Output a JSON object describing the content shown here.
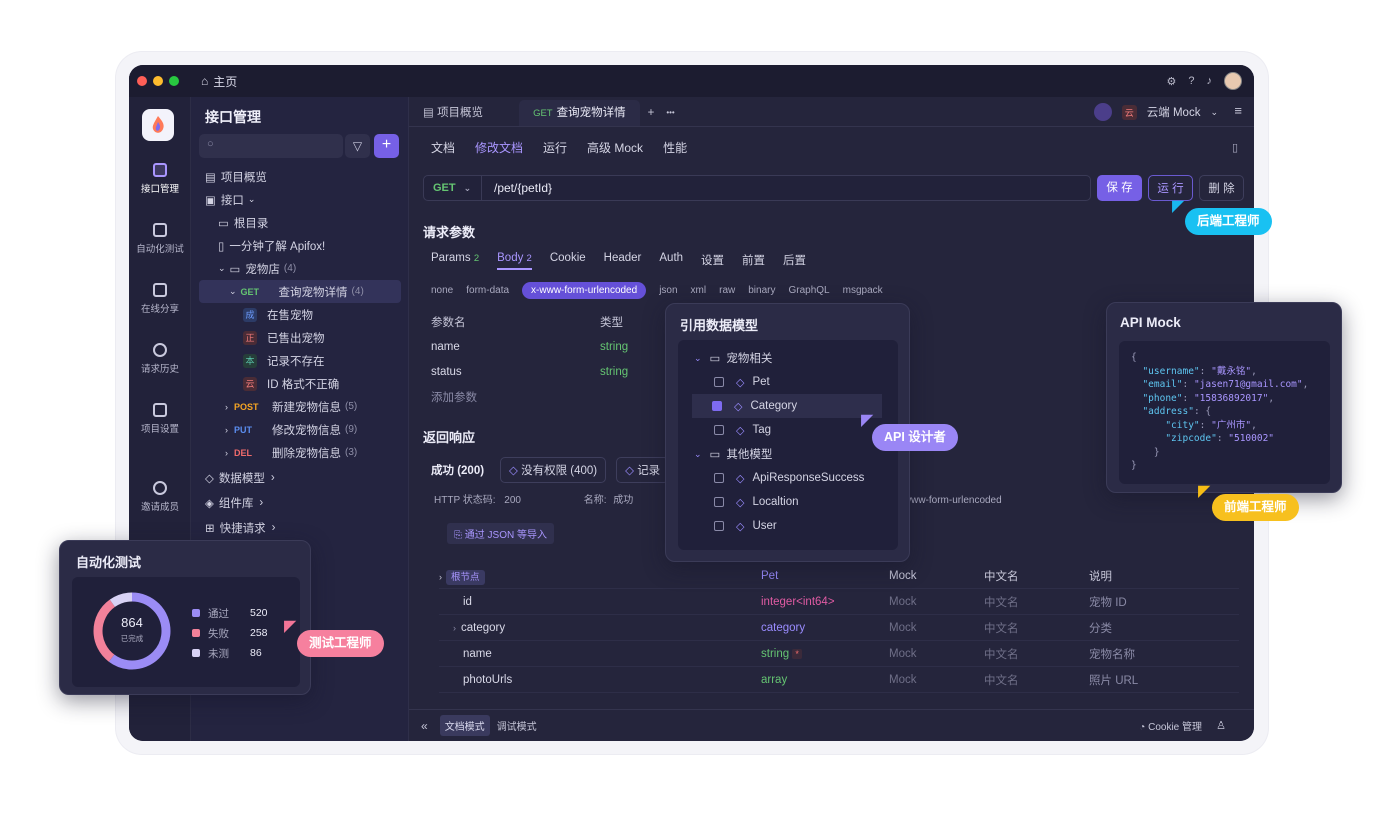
{
  "titlebar": {
    "home": "主页"
  },
  "rail": [
    {
      "label": "接口管理",
      "icon": "api-icon"
    },
    {
      "label": "自动化测试",
      "icon": "test-icon"
    },
    {
      "label": "在线分享",
      "icon": "share-icon"
    },
    {
      "label": "请求历史",
      "icon": "history-icon"
    },
    {
      "label": "项目设置",
      "icon": "settings-icon"
    },
    {
      "label": "邀请成员",
      "icon": "invite-icon"
    }
  ],
  "sidebar": {
    "title": "接口管理",
    "tree": {
      "overview": "项目概览",
      "api": "接口",
      "root": "根目录",
      "intro": "一分钟了解 Apifox!",
      "folder": "宠物店",
      "folder_count": "(4)",
      "get_method": "GET",
      "get_name": "查询宠物详情",
      "get_count": "(4)",
      "cases": [
        {
          "badge": "成",
          "name": "在售宠物"
        },
        {
          "badge": "正",
          "name": "已售出宠物"
        },
        {
          "badge": "本",
          "name": "记录不存在"
        },
        {
          "badge": "云",
          "name": "ID 格式不正确"
        }
      ],
      "post_method": "POST",
      "post_name": "新建宠物信息",
      "post_count": "(5)",
      "put_method": "PUT",
      "put_name": "修改宠物信息",
      "put_count": "(9)",
      "del_method": "DEL",
      "del_name": "删除宠物信息",
      "del_count": "(3)",
      "schemas": "数据模型",
      "components": "组件库",
      "quick": "快捷请求"
    }
  },
  "tabs": {
    "overview": "项目概览",
    "active_method": "GET",
    "active_name": "查询宠物详情",
    "add": "+",
    "more": "•••",
    "env": "云端 Mock",
    "env_badge": "云"
  },
  "subtabs": [
    "文档",
    "修改文档",
    "运行",
    "高级 Mock",
    "性能"
  ],
  "request": {
    "method": "GET",
    "url": "/pet/{petId}",
    "save": "保 存",
    "run": "运 行",
    "delete": "删 除"
  },
  "params": {
    "title": "请求参数",
    "tabs": [
      {
        "label": "Params",
        "count": "2"
      },
      {
        "label": "Body",
        "count": "2"
      },
      {
        "label": "Cookie"
      },
      {
        "label": "Header"
      },
      {
        "label": "Auth"
      },
      {
        "label": "设置"
      },
      {
        "label": "前置"
      },
      {
        "label": "后置"
      }
    ],
    "body_types": [
      "none",
      "form-data",
      "x-www-form-urlencoded",
      "json",
      "xml",
      "raw",
      "binary",
      "GraphQL",
      "msgpack"
    ],
    "headers": [
      "参数名",
      "类型"
    ],
    "rows": [
      {
        "name": "name",
        "type": "string"
      },
      {
        "name": "status",
        "type": "string"
      }
    ],
    "add": "添加参数",
    "status_desc": "状态"
  },
  "response": {
    "title": "返回响应",
    "tabs": [
      "成功 (200)",
      "没有权限 (400)",
      "记录"
    ],
    "status_label": "HTTP 状态码:",
    "status_value": "200",
    "name_label": "名称:",
    "name_value": "成功",
    "content_type": "plication/x-www-form-urlencoded",
    "import": "通过 JSON 等导入",
    "schema_header": [
      "根节点",
      "Pet",
      "Mock",
      "中文名",
      "说明"
    ],
    "schema_rows": [
      {
        "name": "id",
        "type": "integer<int64>",
        "mock": "Mock",
        "cn": "中文名",
        "desc": "宠物 ID"
      },
      {
        "name": "category",
        "type": "category",
        "mock": "Mock",
        "cn": "中文名",
        "desc": "分类"
      },
      {
        "name": "name",
        "type": "string",
        "required": "*",
        "mock": "Mock",
        "cn": "中文名",
        "desc": "宠物名称"
      },
      {
        "name": "photoUrls",
        "type": "array",
        "mock": "Mock",
        "cn": "中文名",
        "desc": "照片 URL"
      }
    ]
  },
  "bottom": {
    "doc_mode": "文档模式",
    "debug_mode": "调试模式",
    "cookie": "Cookie 管理"
  },
  "model_popup": {
    "title": "引用数据模型",
    "group1": "宠物相关",
    "group1_items": [
      "Pet",
      "Category",
      "Tag"
    ],
    "group2": "其他模型",
    "group2_items": [
      "ApiResponseSuccess",
      "Localtion",
      "User"
    ]
  },
  "mock_popup": {
    "title": "API Mock",
    "code": "{\n  \"username\": \"戴永铭\",\n  \"email\": \"jasen71@gmail.com\",\n  \"phone\": \"15836892017\",\n  \"address\": {\n      \"city\": \"广州市\",\n      \"zipcode\": \"510002\"\n    }\n}"
  },
  "auto_popup": {
    "title": "自动化测试",
    "total": "864",
    "total_label": "已完成",
    "legend": [
      {
        "label": "通过",
        "value": "520",
        "color": "#9b8cf5"
      },
      {
        "label": "失败",
        "value": "258",
        "color": "#f2819a"
      },
      {
        "label": "未测",
        "value": "86",
        "color": "#d8d2f5"
      }
    ]
  },
  "role_tags": {
    "backend": "后端工程师",
    "designer": "API 设计者",
    "frontend": "前端工程师",
    "tester": "测试工程师"
  }
}
